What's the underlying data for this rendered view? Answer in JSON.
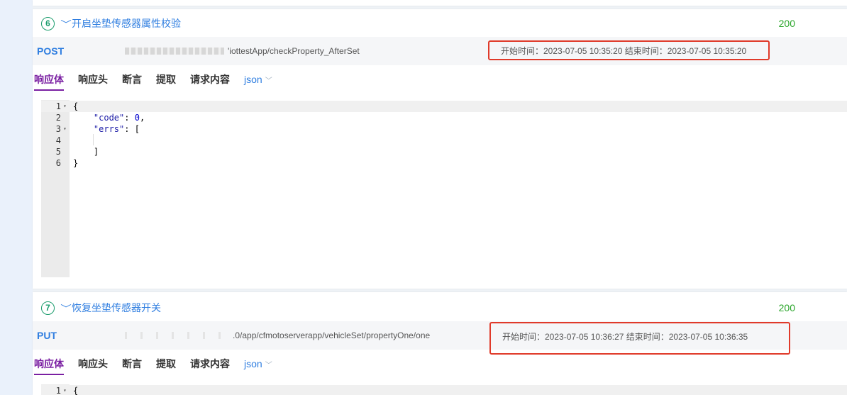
{
  "cards": [
    {
      "index": "6",
      "title": "开启坐垫传感器属性校验",
      "status": "200",
      "method": "POST",
      "url_suffix": "'iottestApp/checkProperty_AfterSet",
      "time_text": "开始时间：2023-07-05 10:35:20 结束时间：2023-07-05 10:35:20",
      "tabs": [
        "响应体",
        "响应头",
        "断言",
        "提取",
        "请求内容"
      ],
      "format": "json",
      "code_lines": [
        {
          "n": "1",
          "fold": true,
          "text": "{"
        },
        {
          "n": "2",
          "fold": false,
          "text": "    \"code\": 0,"
        },
        {
          "n": "3",
          "fold": true,
          "text": "    \"errs\": ["
        },
        {
          "n": "4",
          "fold": false,
          "text": ""
        },
        {
          "n": "5",
          "fold": false,
          "text": "    ]"
        },
        {
          "n": "6",
          "fold": false,
          "text": "}"
        }
      ]
    },
    {
      "index": "7",
      "title": "恢复坐垫传感器开关",
      "status": "200",
      "method": "PUT",
      "url_suffix": ".0/app/cfmotoserverapp/vehicleSet/propertyOne/one",
      "time_text": "开始时间：2023-07-05 10:36:27 结束时间：2023-07-05 10:36:35",
      "tabs": [
        "响应体",
        "响应头",
        "断言",
        "提取",
        "请求内容"
      ],
      "format": "json",
      "code_lines": [
        {
          "n": "1",
          "fold": true,
          "text": "{"
        }
      ]
    }
  ],
  "colors": {
    "accent_blue": "#2f7ee0",
    "status_green": "#2aa52a",
    "highlight_red": "#e03a2a",
    "active_tab": "#7a1fa2"
  },
  "icons": [
    "chevron-down-icon",
    "fold-arrow-icon"
  ]
}
